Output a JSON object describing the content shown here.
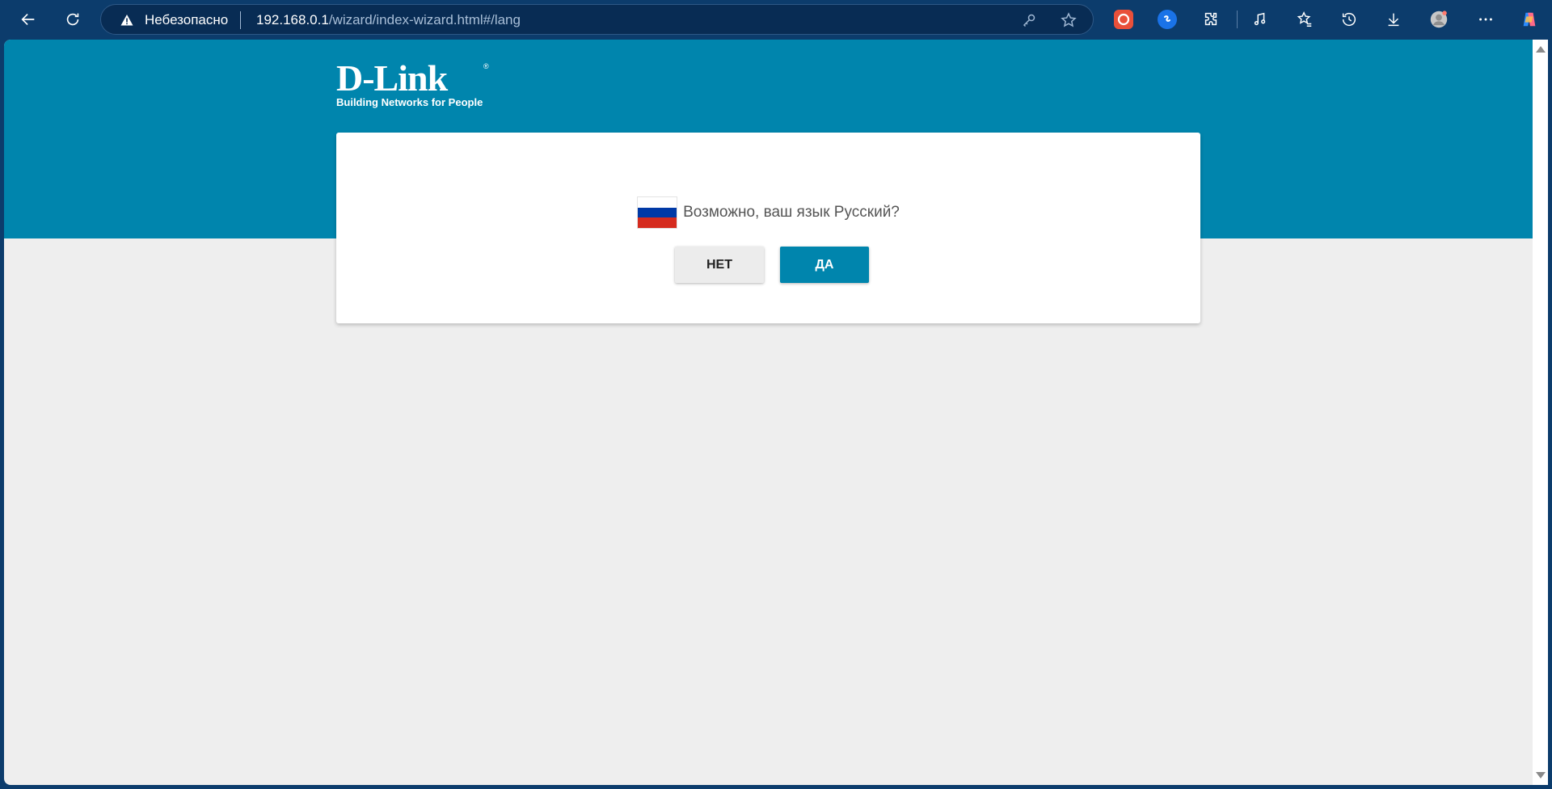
{
  "browser": {
    "security_label": "Небезопасно",
    "url_host": "192.168.0.1",
    "url_path": "/wizard/index-wizard.html#/lang",
    "accent": "#0c3c6c"
  },
  "logo": {
    "brand": "D-Link",
    "registered": "®",
    "tagline": "Building Networks for People"
  },
  "dialog": {
    "question": "Возможно, ваш язык Русский?",
    "no_label": "НЕТ",
    "yes_label": "ДА",
    "flag_colors": [
      "#ffffff",
      "#0039a6",
      "#d52b1e"
    ]
  },
  "colors": {
    "brand": "#0085ad",
    "page_bg": "#eeeeee"
  },
  "icons": [
    "back-icon",
    "reload-icon",
    "warning-icon",
    "key-icon",
    "favorite-star-icon",
    "extension-icon",
    "media-icon",
    "favorites-icon",
    "history-icon",
    "download-icon",
    "profile-icon",
    "more-icon",
    "copilot-icon"
  ]
}
